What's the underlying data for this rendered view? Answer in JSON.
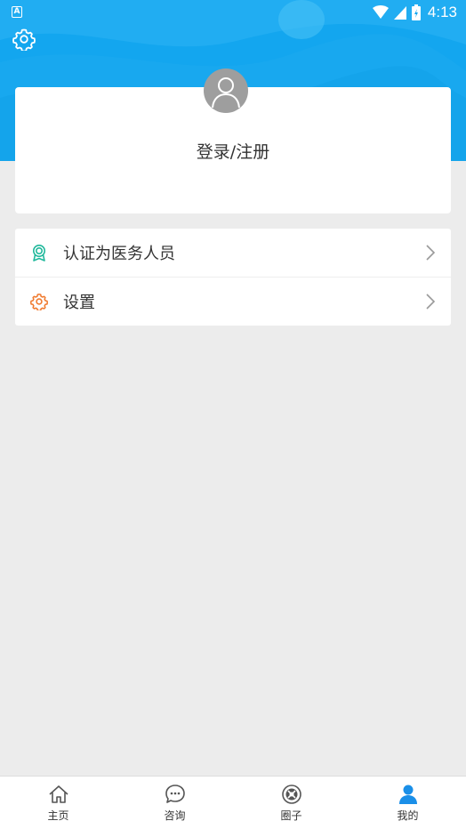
{
  "status_bar": {
    "time": "4:13",
    "left_icon_letter": "A"
  },
  "profile": {
    "login_label": "登录/注册"
  },
  "menu": {
    "items": [
      {
        "label": "认证为医务人员",
        "icon": "certificate-badge-icon",
        "color": "#1fb89b"
      },
      {
        "label": "设置",
        "icon": "gear-icon",
        "color": "#f07a2e"
      }
    ]
  },
  "bottom_nav": {
    "items": [
      {
        "label": "主页",
        "icon": "home-icon",
        "active": false
      },
      {
        "label": "咨询",
        "icon": "chat-bubble-icon",
        "active": false
      },
      {
        "label": "圈子",
        "icon": "circle-aperture-icon",
        "active": false
      },
      {
        "label": "我的",
        "icon": "user-icon",
        "active": true
      }
    ]
  },
  "colors": {
    "header_blue": "#13a6ef",
    "active_blue": "#1a8fe8"
  }
}
